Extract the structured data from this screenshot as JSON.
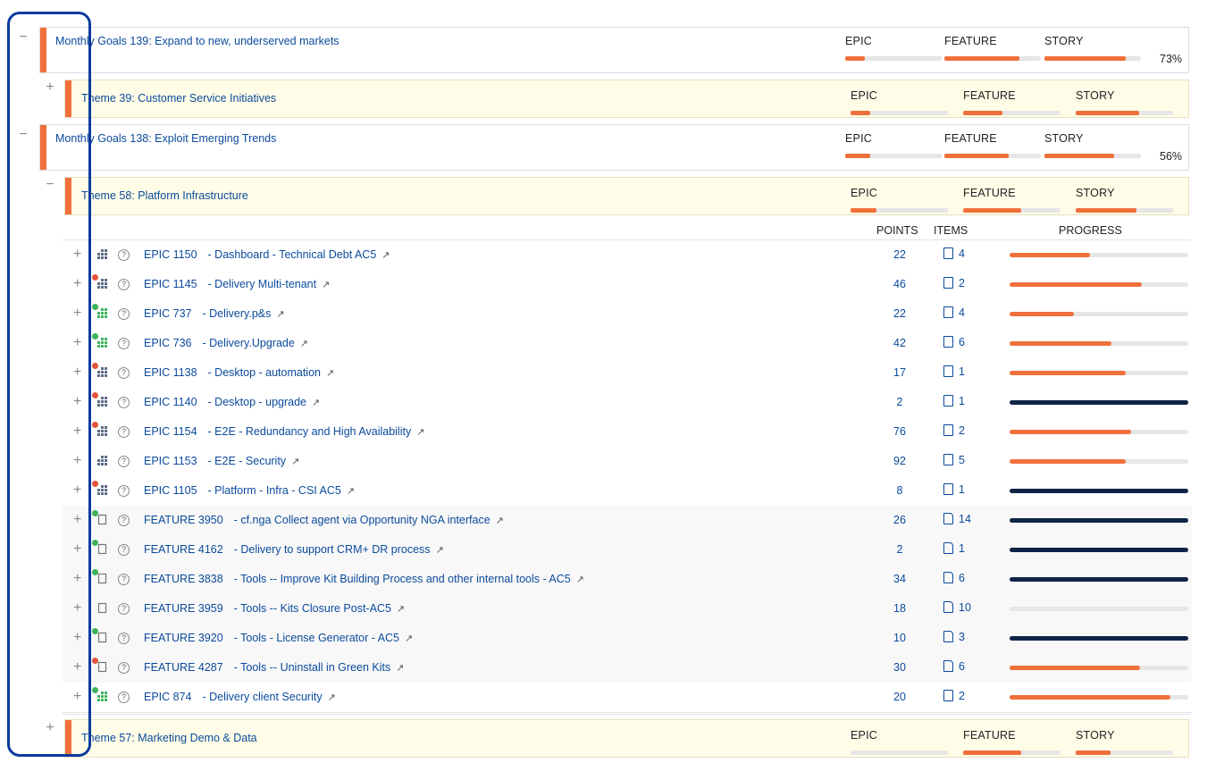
{
  "metric_labels": {
    "epic": "EPIC",
    "feature": "FEATURE",
    "story": "STORY"
  },
  "table_headers": {
    "points": "POINTS",
    "items": "ITEMS",
    "progress": "PROGRESS"
  },
  "colors": {
    "accent": "#f0703b",
    "complete": "#0f2547",
    "link": "#0b4a9c",
    "theme_bg": "#fffde7",
    "dot_red": "#e2553b",
    "dot_green": "#3cb35a"
  },
  "goals": [
    {
      "toggle": "−",
      "title": "Monthly Goals 139: Expand to new, underserved markets",
      "pct": "73%",
      "epic": 0.2,
      "feature": 0.78,
      "story": 0.84
    },
    {
      "toggle": "−",
      "title": "Monthly Goals 138: Exploit Emerging Trends",
      "pct": "56%",
      "epic": 0.26,
      "feature": 0.67,
      "story": 0.72
    }
  ],
  "themes": [
    {
      "toggle": "+",
      "title": "Theme 39: Customer Service Initiatives",
      "epic": 0.2,
      "feature": 0.4,
      "story": 0.65
    },
    {
      "toggle": "−",
      "title": "Theme 58: Platform Infrastructure",
      "epic": 0.27,
      "feature": 0.6,
      "story": 0.62
    },
    {
      "toggle": "+",
      "title": "Theme 57: Marketing Demo & Data",
      "epic": 0.0,
      "feature": 0.6,
      "story": 0.36
    }
  ],
  "rows": [
    {
      "kind": "epic",
      "id": "EPIC 1150",
      "title": "- Dashboard - Technical Debt AC5",
      "points": "22",
      "items": "4",
      "progress": 0.45,
      "done": false,
      "dot": "",
      "green_icon": false
    },
    {
      "kind": "epic",
      "id": "EPIC 1145",
      "title": "- Delivery Multi-tenant",
      "points": "46",
      "items": "2",
      "progress": 0.74,
      "done": false,
      "dot": "red",
      "green_icon": false
    },
    {
      "kind": "epic",
      "id": "EPIC 737",
      "title": "- Delivery.p&s",
      "points": "22",
      "items": "4",
      "progress": 0.36,
      "done": false,
      "dot": "green",
      "green_icon": true
    },
    {
      "kind": "epic",
      "id": "EPIC 736",
      "title": "- Delivery.Upgrade",
      "points": "42",
      "items": "6",
      "progress": 0.57,
      "done": false,
      "dot": "green",
      "green_icon": true
    },
    {
      "kind": "epic",
      "id": "EPIC 1138",
      "title": "- Desktop - automation",
      "points": "17",
      "items": "1",
      "progress": 0.65,
      "done": false,
      "dot": "red",
      "green_icon": false
    },
    {
      "kind": "epic",
      "id": "EPIC 1140",
      "title": "- Desktop - upgrade",
      "points": "2",
      "items": "1",
      "progress": 1.0,
      "done": true,
      "dot": "red",
      "green_icon": false
    },
    {
      "kind": "epic",
      "id": "EPIC 1154",
      "title": "- E2E - Redundancy and High Availability",
      "points": "76",
      "items": "2",
      "progress": 0.68,
      "done": false,
      "dot": "red",
      "green_icon": false
    },
    {
      "kind": "epic",
      "id": "EPIC 1153",
      "title": "- E2E - Security",
      "points": "92",
      "items": "5",
      "progress": 0.65,
      "done": false,
      "dot": "",
      "green_icon": false
    },
    {
      "kind": "epic",
      "id": "EPIC 1105",
      "title": "- Platform - Infra - CSI AC5",
      "points": "8",
      "items": "1",
      "progress": 1.0,
      "done": true,
      "dot": "red",
      "green_icon": false
    },
    {
      "kind": "feature",
      "id": "FEATURE 3950",
      "title": "- cf.nga Collect agent via Opportunity NGA interface",
      "points": "26",
      "items": "14",
      "progress": 1.0,
      "done": true,
      "dot": "green",
      "green_icon": false
    },
    {
      "kind": "feature",
      "id": "FEATURE 4162",
      "title": "- Delivery to support CRM+ DR process",
      "points": "2",
      "items": "1",
      "progress": 1.0,
      "done": true,
      "dot": "green",
      "green_icon": false
    },
    {
      "kind": "feature",
      "id": "FEATURE 3838",
      "title": "- Tools -- Improve Kit Building Process and other internal tools - AC5",
      "points": "34",
      "items": "6",
      "progress": 1.0,
      "done": true,
      "dot": "green",
      "green_icon": false
    },
    {
      "kind": "feature",
      "id": "FEATURE 3959",
      "title": "- Tools -- Kits Closure Post-AC5",
      "points": "18",
      "items": "10",
      "progress": 0.0,
      "done": false,
      "dot": "",
      "green_icon": false
    },
    {
      "kind": "feature",
      "id": "FEATURE 3920",
      "title": "- Tools - License Generator - AC5",
      "points": "10",
      "items": "3",
      "progress": 1.0,
      "done": true,
      "dot": "green",
      "green_icon": false
    },
    {
      "kind": "feature",
      "id": "FEATURE 4287",
      "title": "- Tools -- Uninstall in Green Kits",
      "points": "30",
      "items": "6",
      "progress": 0.73,
      "done": false,
      "dot": "red",
      "green_icon": false
    },
    {
      "kind": "epic",
      "id": "EPIC 874",
      "title": "- Delivery client Security",
      "points": "20",
      "items": "2",
      "progress": 0.9,
      "done": false,
      "dot": "green",
      "green_icon": true
    }
  ],
  "expand_symbol": "+",
  "help_symbol": "?",
  "external_symbol": "↗"
}
